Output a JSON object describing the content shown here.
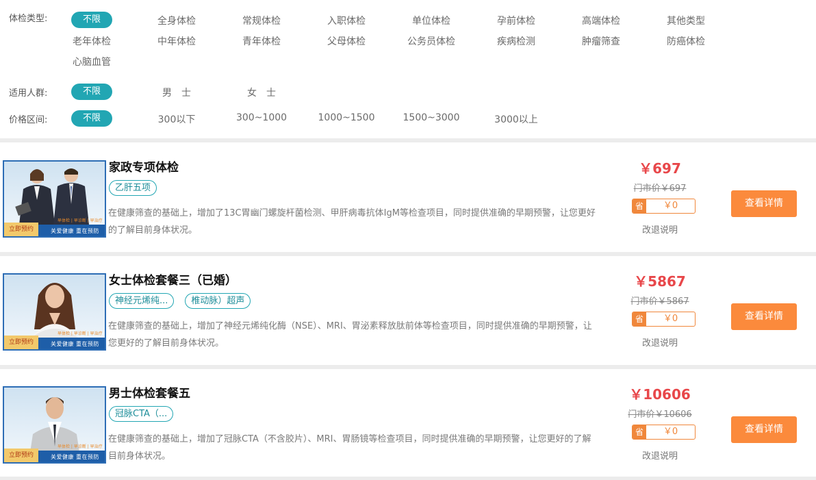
{
  "filters": {
    "type": {
      "label": "体检类型:",
      "options": [
        "不限",
        "全身体检",
        "常规体检",
        "入职体检",
        "单位体检",
        "孕前体检",
        "高端体检",
        "其他类型",
        "老年体检",
        "中年体检",
        "青年体检",
        "父母体检",
        "公务员体检",
        "疾病检测",
        "肿瘤筛查",
        "防癌体检",
        "心脑血管"
      ]
    },
    "crowd": {
      "label": "适用人群:",
      "options": [
        "不限",
        "男　士",
        "女　士"
      ]
    },
    "price": {
      "label": "价格区间:",
      "options": [
        "不限",
        "300以下",
        "300~1000",
        "1000~1500",
        "1500~3000",
        "3000以上"
      ]
    }
  },
  "thumb": {
    "book": "立即预约",
    "banner": "关爱健康  重在预防",
    "mini": "早体检 | 早诊断 | 早治疗"
  },
  "items": [
    {
      "title": "家政专项体检",
      "tags": [
        "乙肝五项"
      ],
      "desc": "在健康筛查的基础上，增加了13C胃幽门螺旋杆菌检测、甲肝病毒抗体IgM等检查项目，同时提供准确的早期预警，让您更好的了解目前身体状况。",
      "price": "￥697",
      "market": "门市价￥697",
      "save_label": "省",
      "save": "￥0",
      "refund": "改退说明",
      "button": "查看详情"
    },
    {
      "title": "女士体检套餐三（已婚）",
      "tags": [
        "神经元烯纯...",
        "椎动脉）超声"
      ],
      "desc": "在健康筛查的基础上，增加了神经元烯纯化酶（NSE）、MRI、胃泌素释放肽前体等检查项目，同时提供准确的早期预警，让您更好的了解目前身体状况。",
      "price": "￥5867",
      "market": "门市价￥5867",
      "save_label": "省",
      "save": "￥0",
      "refund": "改退说明",
      "button": "查看详情"
    },
    {
      "title": "男士体检套餐五",
      "tags": [
        "冠脉CTA（..."
      ],
      "desc": "在健康筛查的基础上，增加了冠脉CTA（不含胶片）、MRI、胃肠镜等检查项目，同时提供准确的早期预警，让您更好的了解目前身体状况。",
      "price": "￥10606",
      "market": "门市价￥10606",
      "save_label": "省",
      "save": "￥0",
      "refund": "改退说明",
      "button": "查看详情"
    }
  ]
}
